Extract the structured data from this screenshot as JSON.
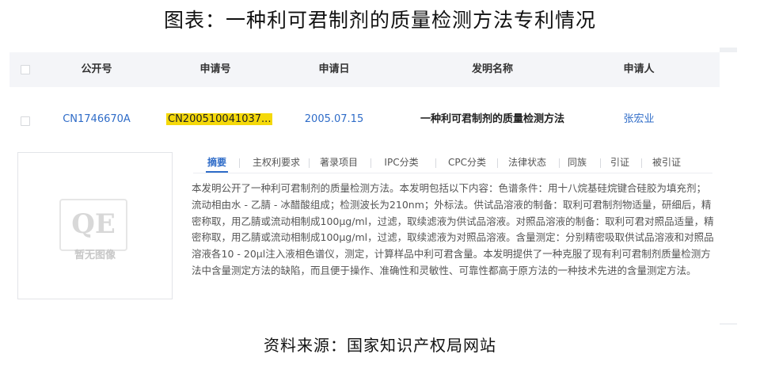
{
  "page_title": "图表：一种利可君制剂的质量检测方法专利情况",
  "table": {
    "headers": {
      "publication_no": "公开号",
      "application_no": "申请号",
      "application_date": "申请日",
      "invention_name": "发明名称",
      "applicant": "申请人"
    },
    "row": {
      "publication_no": "CN1746670A",
      "application_no": "CN200510041037...",
      "application_date": "2005.07.15",
      "invention_name": "一种利可君制剂的质量检测方法",
      "applicant": "张宏业"
    }
  },
  "thumbnail": {
    "placeholder_text": "暂无图像"
  },
  "tabs": [
    {
      "label": "摘要",
      "active": true
    },
    {
      "label": "主权利要求"
    },
    {
      "label": "著录项目"
    },
    {
      "label": "IPC分类"
    },
    {
      "label": "CPC分类"
    },
    {
      "label": "法律状态"
    },
    {
      "label": "同族"
    },
    {
      "label": "引证"
    },
    {
      "label": "被引证"
    }
  ],
  "abstract": "本发明公开了一种利可君制剂的质量检测方法。本发明包括以下内容：色谱条件：用十八烷基硅烷键合硅胶为填充剂；流动相由水 - 乙腈 - 冰醋酸组成；检测波长为210nm；外标法。供试品溶液的制备：取利可君制剂物适量，研细后，精密称取，用乙腈或流动相制成100μg/ml，过滤，取续滤液为供试品溶液。对照品溶液的制备：取利可君对照品适量，精密称取，用乙腈或流动相制成100μg/ml，过滤，取续滤液为对照品溶液。含量测定：分别精密吸取供试品溶液和对照品溶液各10 - 20μl注入液相色谱仪，测定，计算样品中利可君含量。本发明提供了一种克服了现有利可君制剂质量检测方法中含量测定方法的缺陷，而且便于操作、准确性和灵敏性、可靠性都高于原方法的一种技术先进的含量测定方法。",
  "source": "资料来源：国家知识产权局网站",
  "colors": {
    "link": "#2f6cc8",
    "highlight": "#f5d90a",
    "header_bg": "#f4f5f8"
  }
}
